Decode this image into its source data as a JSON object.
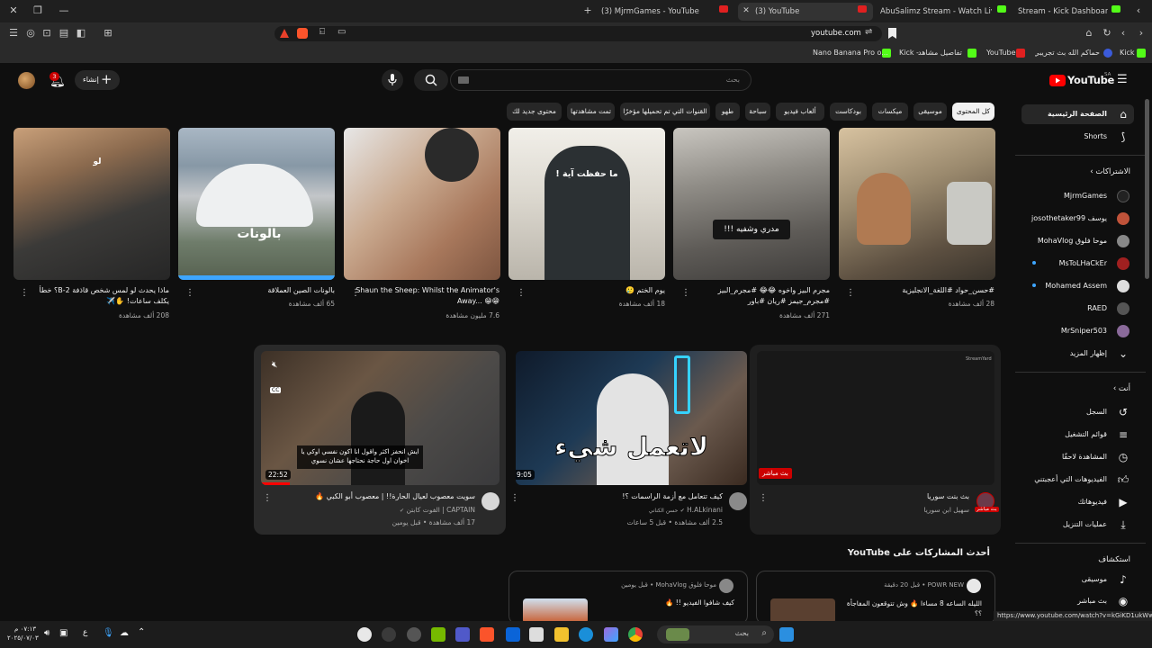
{
  "browser": {
    "tabs": [
      {
        "label": "(3) MjrmGames - YouTube"
      },
      {
        "label": "(3) YouTube"
      },
      {
        "label": "AbuSalimz Stream - Watch Live on Ki"
      },
      {
        "label": "Stream - Kick Dashboard"
      }
    ],
    "url": "youtube.com",
    "bookmarks": [
      {
        "label": "Kick"
      },
      {
        "label": "حماكم الله بث تجريبي..."
      },
      {
        "label": "YouTube"
      },
      {
        "label": "تفاصيل مشاهد"
      },
      {
        "label": "Kick -"
      },
      {
        "label": "Nano Banana Pro o..."
      }
    ],
    "status_url": "https://www.youtube.com/watch?v=kGiKD1ukWwQ"
  },
  "header": {
    "logo": "YouTube",
    "logo_sup": "SA",
    "search_placeholder": "بحث",
    "create_label": "إنشاء",
    "notif_count": "3"
  },
  "chips": [
    "كل المحتوى",
    "موسيقى",
    "ميكسات",
    "بودكاست",
    "ألعاب فيديو",
    "سباحة",
    "طهو",
    "القنوات التي تم تحميلها مؤخرًا",
    "تمت مشاهدتها",
    "محتوى جديد لك"
  ],
  "shorts": [
    {
      "title": "#حسن_حواد #اللغة_الانجليزية",
      "views": "28 ألف مشاهدة",
      "overlay": ""
    },
    {
      "title": "مجرم البيز واخوه 😂😂 #مجرم_البيز #مجرم_جيمز #ريان #باور",
      "views": "271 ألف مشاهدة",
      "overlay": "مدري وشفيه !!!"
    },
    {
      "title": "يوم الختم 🥲",
      "views": "18 ألف مشاهدة",
      "overlay": "ما حفظت آية !"
    },
    {
      "title": "Shaun the Sheep: Whilst the Animator's Away... 😁😁",
      "views": "7.6 مليون مشاهدة",
      "overlay": ""
    },
    {
      "title": "بالونات الصين العملاقة",
      "views": "65 ألف مشاهدة",
      "overlay": "بالونات"
    },
    {
      "title": "ماذا يحدث لو لمس شخص قاذفة B-2؟ خطأ يكلف ساعات! ✋✈️",
      "views": "208 ألف مشاهدة",
      "overlay": "لو"
    }
  ],
  "videos": [
    {
      "title": "بث بنت سوريا",
      "channel": "سهيل ابن سوريا",
      "meta": "",
      "duration": "",
      "live_badge": "بث مباشر",
      "live_tag": "بث مباشر",
      "thumb_logo": "StreamYard"
    },
    {
      "title": "كيف تتعامل مع أزمة الراسمات ؟!",
      "channel": "H.ALkinani",
      "channel_sub": "حسن الكناني",
      "meta": "2.5 ألف مشاهدة • قبل 5 ساعات",
      "duration": "9:05",
      "overlay": "لاتعمل شيء"
    },
    {
      "title": "سويت معصوب لعيال الحارة!! | معصوب أبو الكبي 🔥",
      "channel": "CAPTAIN | الفوت كابتن",
      "meta": "17 ألف مشاهدة • قبل يومين",
      "duration": "22:52",
      "overlay": "ايش انحفز اكثر واقول انا اكون نفسي اوكي يا اخوان اول حاجة نحتاجها عشان نسوي",
      "cc": "CC"
    }
  ],
  "community": {
    "heading": "أحدث المشاركات على YouTube",
    "posts": [
      {
        "channel": "POWR NEW • قبل 20 دقيقة",
        "text": "الليله الساعه 8 مساءا 🔥 وش تتوقعون المفاجأة ؟؟"
      },
      {
        "channel": "موحا فلوق MohaVlog • قبل يومين",
        "text": "كيف شافوا الفيديو !! 🔥"
      }
    ]
  },
  "sidebar": {
    "main": [
      {
        "label": "الصفحة الرئيسية",
        "icon": "home-icon"
      },
      {
        "label": "Shorts",
        "icon": "shorts-icon"
      }
    ],
    "subs_heading": "الاشتراكات",
    "subs": [
      {
        "label": "MjrmGames",
        "color": "#222"
      },
      {
        "label": "يوسف josothetaker99",
        "color": "#c0533a"
      },
      {
        "label": "موحا فلوق MohaVlog",
        "color": "#888"
      },
      {
        "label": "MsToLHaCkEr",
        "color": "#a02020"
      },
      {
        "label": "Mohamed Assem",
        "color": "#ddd"
      },
      {
        "label": "RAED",
        "color": "#555"
      },
      {
        "label": "MrSniper503",
        "color": "#8a6a9a"
      }
    ],
    "show_more": "إظهار المزيد",
    "you_heading": "أنت",
    "you": [
      {
        "label": "السجل",
        "icon": "history-icon"
      },
      {
        "label": "قوائم التشغيل",
        "icon": "playlists-icon"
      },
      {
        "label": "المشاهدة لاحقًا",
        "icon": "watch-later-icon"
      },
      {
        "label": "الفيديوهات التي أعجبتني",
        "icon": "like-icon"
      },
      {
        "label": "فيديوهاتك",
        "icon": "your-videos-icon"
      },
      {
        "label": "عمليات التنزيل",
        "icon": "download-icon"
      }
    ],
    "explore_heading": "استكشاف",
    "explore": [
      {
        "label": "موسيقى",
        "icon": "music-icon"
      },
      {
        "label": "بث مباشر",
        "icon": "live-icon"
      }
    ]
  },
  "taskbar": {
    "time": "٠٧:١٣ م",
    "date": "٢٠٢٥/٠٧/٠٣",
    "lang": "ع",
    "search_placeholder": "بحث"
  }
}
